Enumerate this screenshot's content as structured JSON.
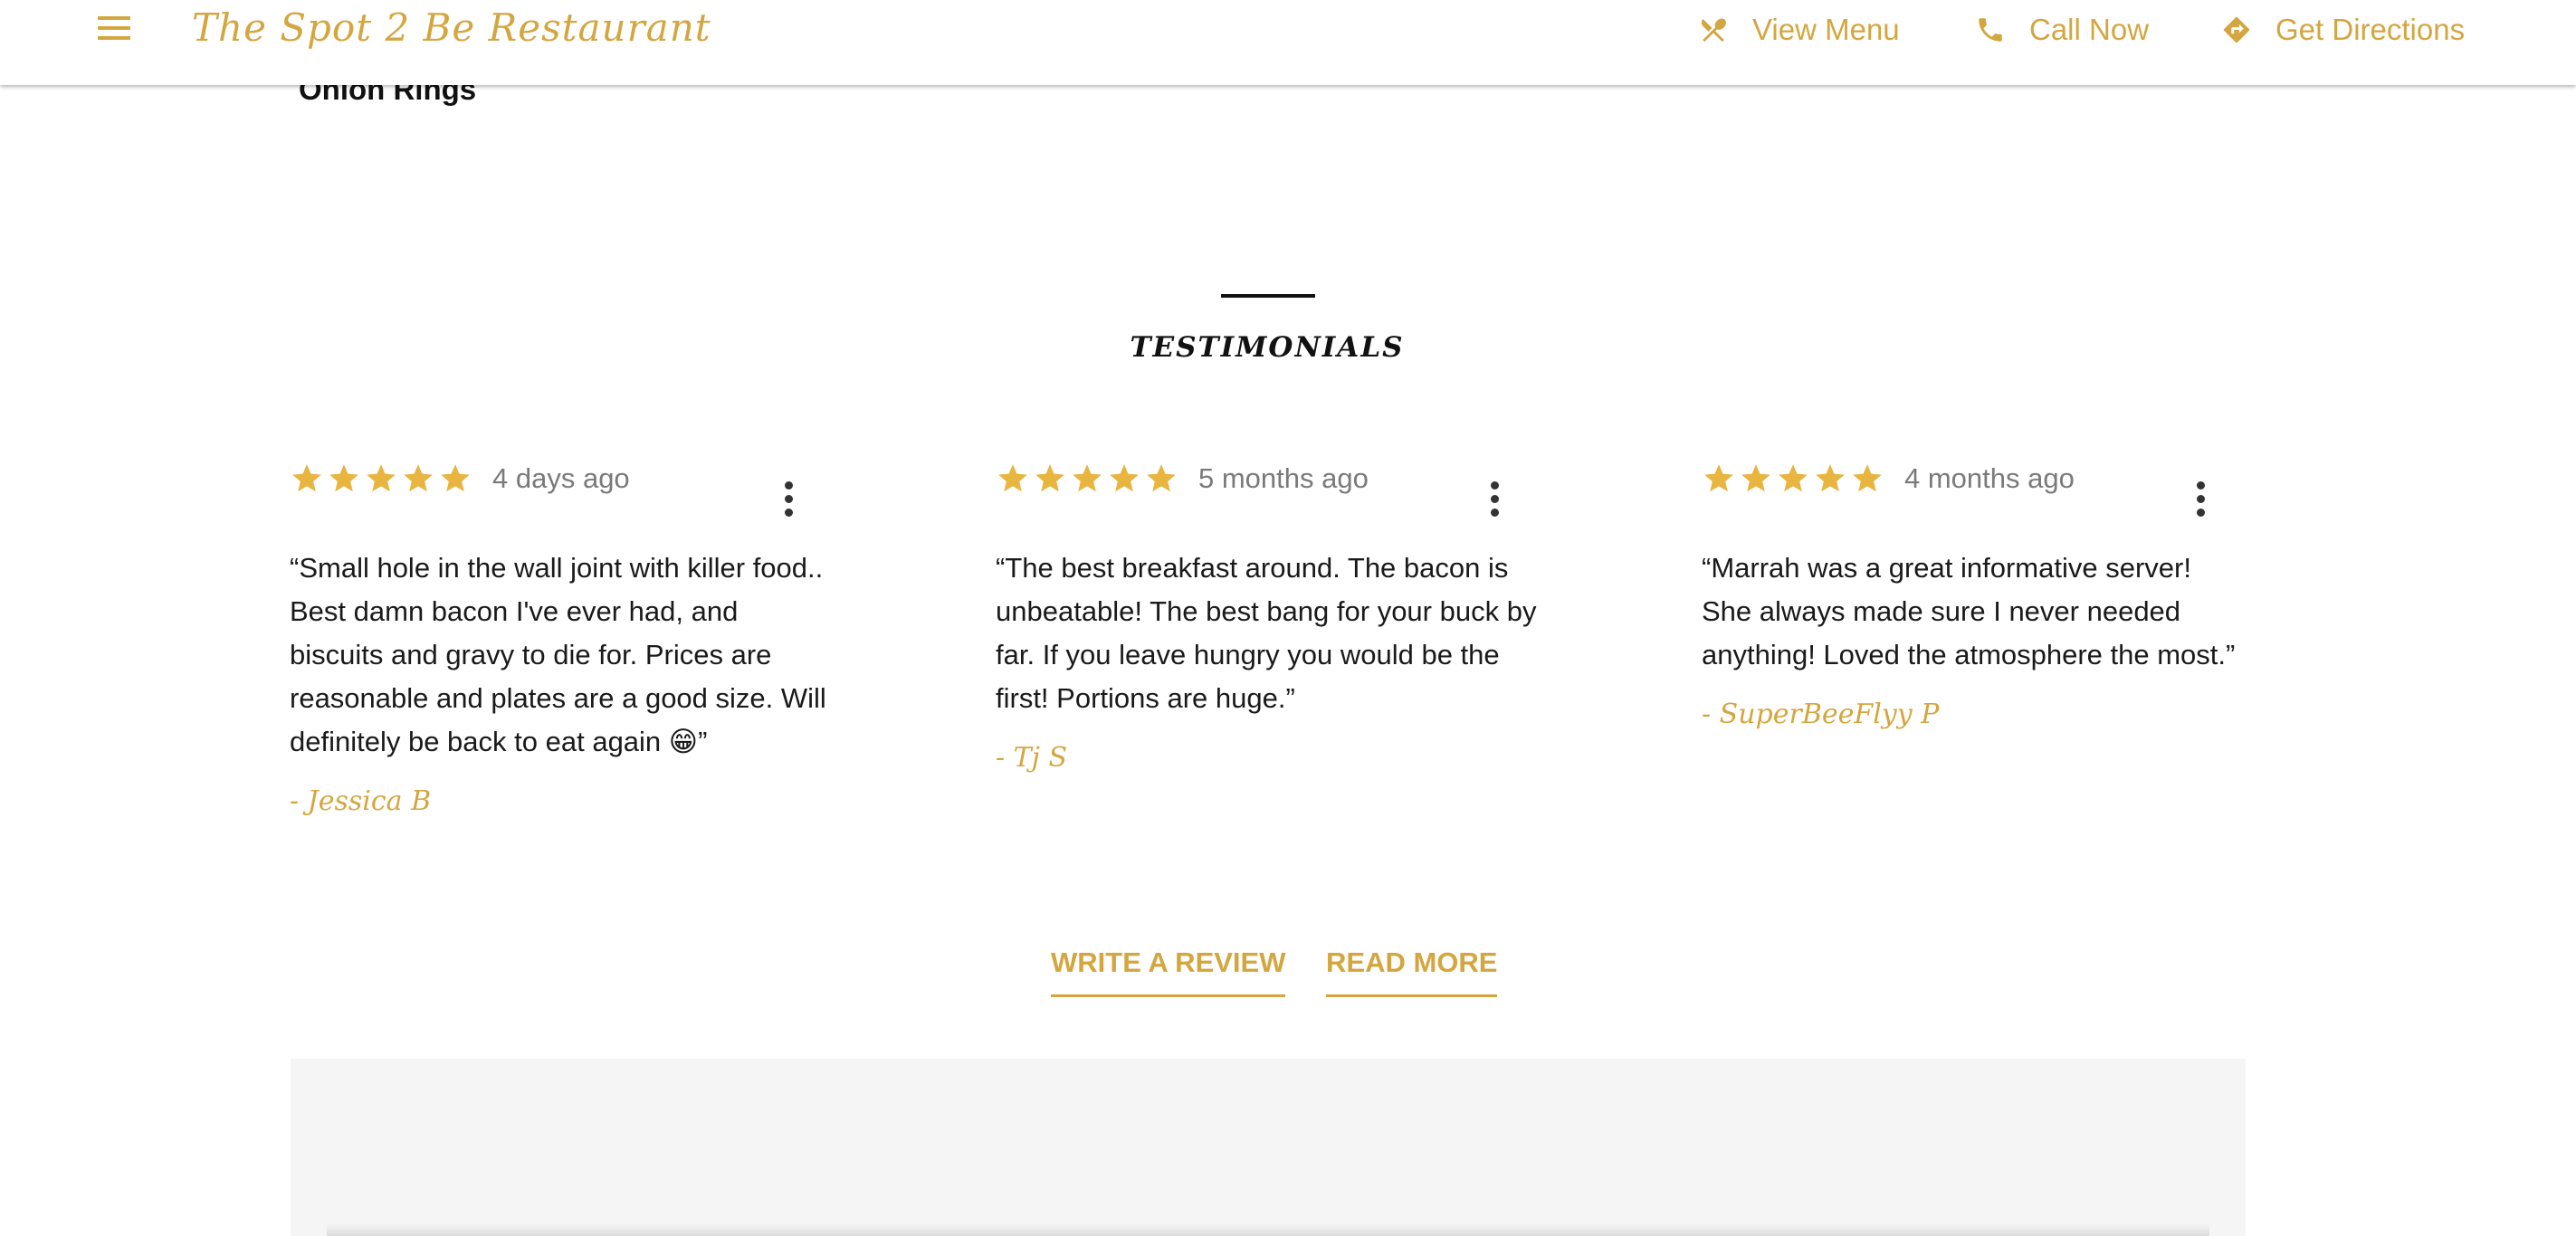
{
  "header": {
    "brand": "The Spot 2 Be Restaurant",
    "nav": {
      "view_menu": "View Menu",
      "call_now": "Call Now",
      "get_directions": "Get Directions"
    }
  },
  "scrolled_item": "Onion Rings",
  "testimonials": {
    "title": "TESTIMONIALS",
    "reviews": [
      {
        "rating": 5,
        "date": "4 days ago",
        "text": "“Small hole in the wall joint with killer food.. Best damn bacon I've ever had, and biscuits and gravy to die for. Prices are reasonable and plates are a good size. Will definitely be back to eat again 😁”",
        "author": "- Jessica B"
      },
      {
        "rating": 5,
        "date": "5 months ago",
        "text": "“The best breakfast around. The bacon is unbeatable! The best bang for your buck by far. If you leave hungry you would be the first! Portions are huge.”",
        "author": "- Tj S"
      },
      {
        "rating": 5,
        "date": "4 months ago",
        "text": "“Marrah was a great informative server! She always made sure I never needed anything! Loved the atmosphere the most.”",
        "author": "- SuperBeeFlyy P"
      }
    ],
    "write_review": "WRITE A REVIEW",
    "read_more": "READ MORE"
  },
  "colors": {
    "accent": "#d4a640",
    "star": "#e8b540",
    "panel": "#f5f5f5"
  },
  "icons": {
    "menu": "hamburger-icon",
    "view_menu": "utensils-icon",
    "call": "phone-icon",
    "directions": "directions-icon",
    "rating": "star-icon",
    "more": "more-vert-icon"
  }
}
